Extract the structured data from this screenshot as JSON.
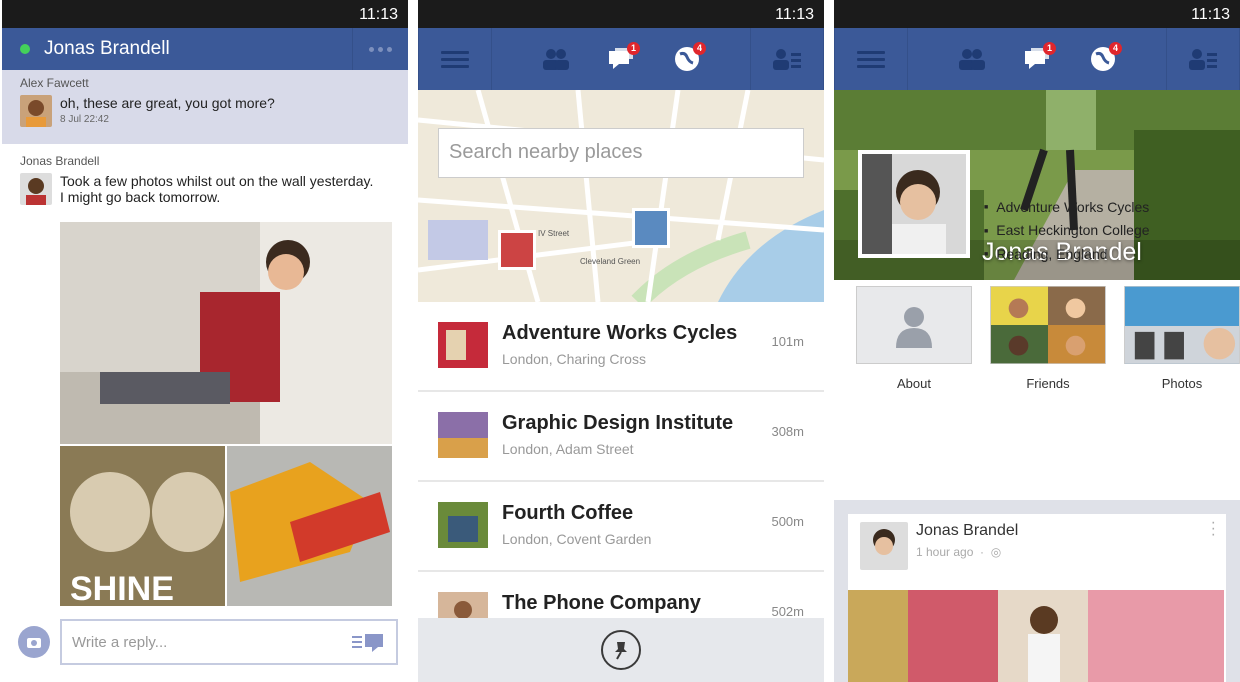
{
  "status": {
    "time": "11:13"
  },
  "chat": {
    "header_name": "Jonas Brandell",
    "message1": {
      "sender": "Alex Fawcett",
      "text": "oh, these are great, you got more?",
      "time": "8 Jul 22:42"
    },
    "message2": {
      "sender": "Jonas Brandell",
      "line1": "Took a few photos whilst out on the wall yesterday.",
      "line2": "I might go back tomorrow."
    },
    "photo_caption": "SHINE",
    "reply_placeholder": "Write a reply..."
  },
  "nav": {
    "messages_badge": "1",
    "notifications_badge": "4"
  },
  "places": {
    "search_placeholder": "Search nearby places",
    "items": [
      {
        "name": "Adventure Works Cycles",
        "address": "London, Charing Cross",
        "distance": "101m"
      },
      {
        "name": "Graphic Design Institute",
        "address": "London, Adam Street",
        "distance": "308m"
      },
      {
        "name": "Fourth Coffee",
        "address": "London, Covent Garden",
        "distance": "500m"
      },
      {
        "name": "The Phone Company",
        "address": "",
        "distance": "502m"
      }
    ],
    "map_labels": [
      "IV Street",
      "Cleveland Green"
    ]
  },
  "profile": {
    "name": "Jonas Brandel",
    "info": [
      "Adventure Works Cycles",
      "East Heckington College",
      "Reading, England"
    ],
    "tiles": [
      "About",
      "Friends",
      "Photos"
    ],
    "post": {
      "name": "Jonas Brandel",
      "time": "1 hour ago"
    }
  },
  "colors": {
    "brand": "#3b5998",
    "badge": "#e0262c",
    "online": "#44d05a"
  }
}
